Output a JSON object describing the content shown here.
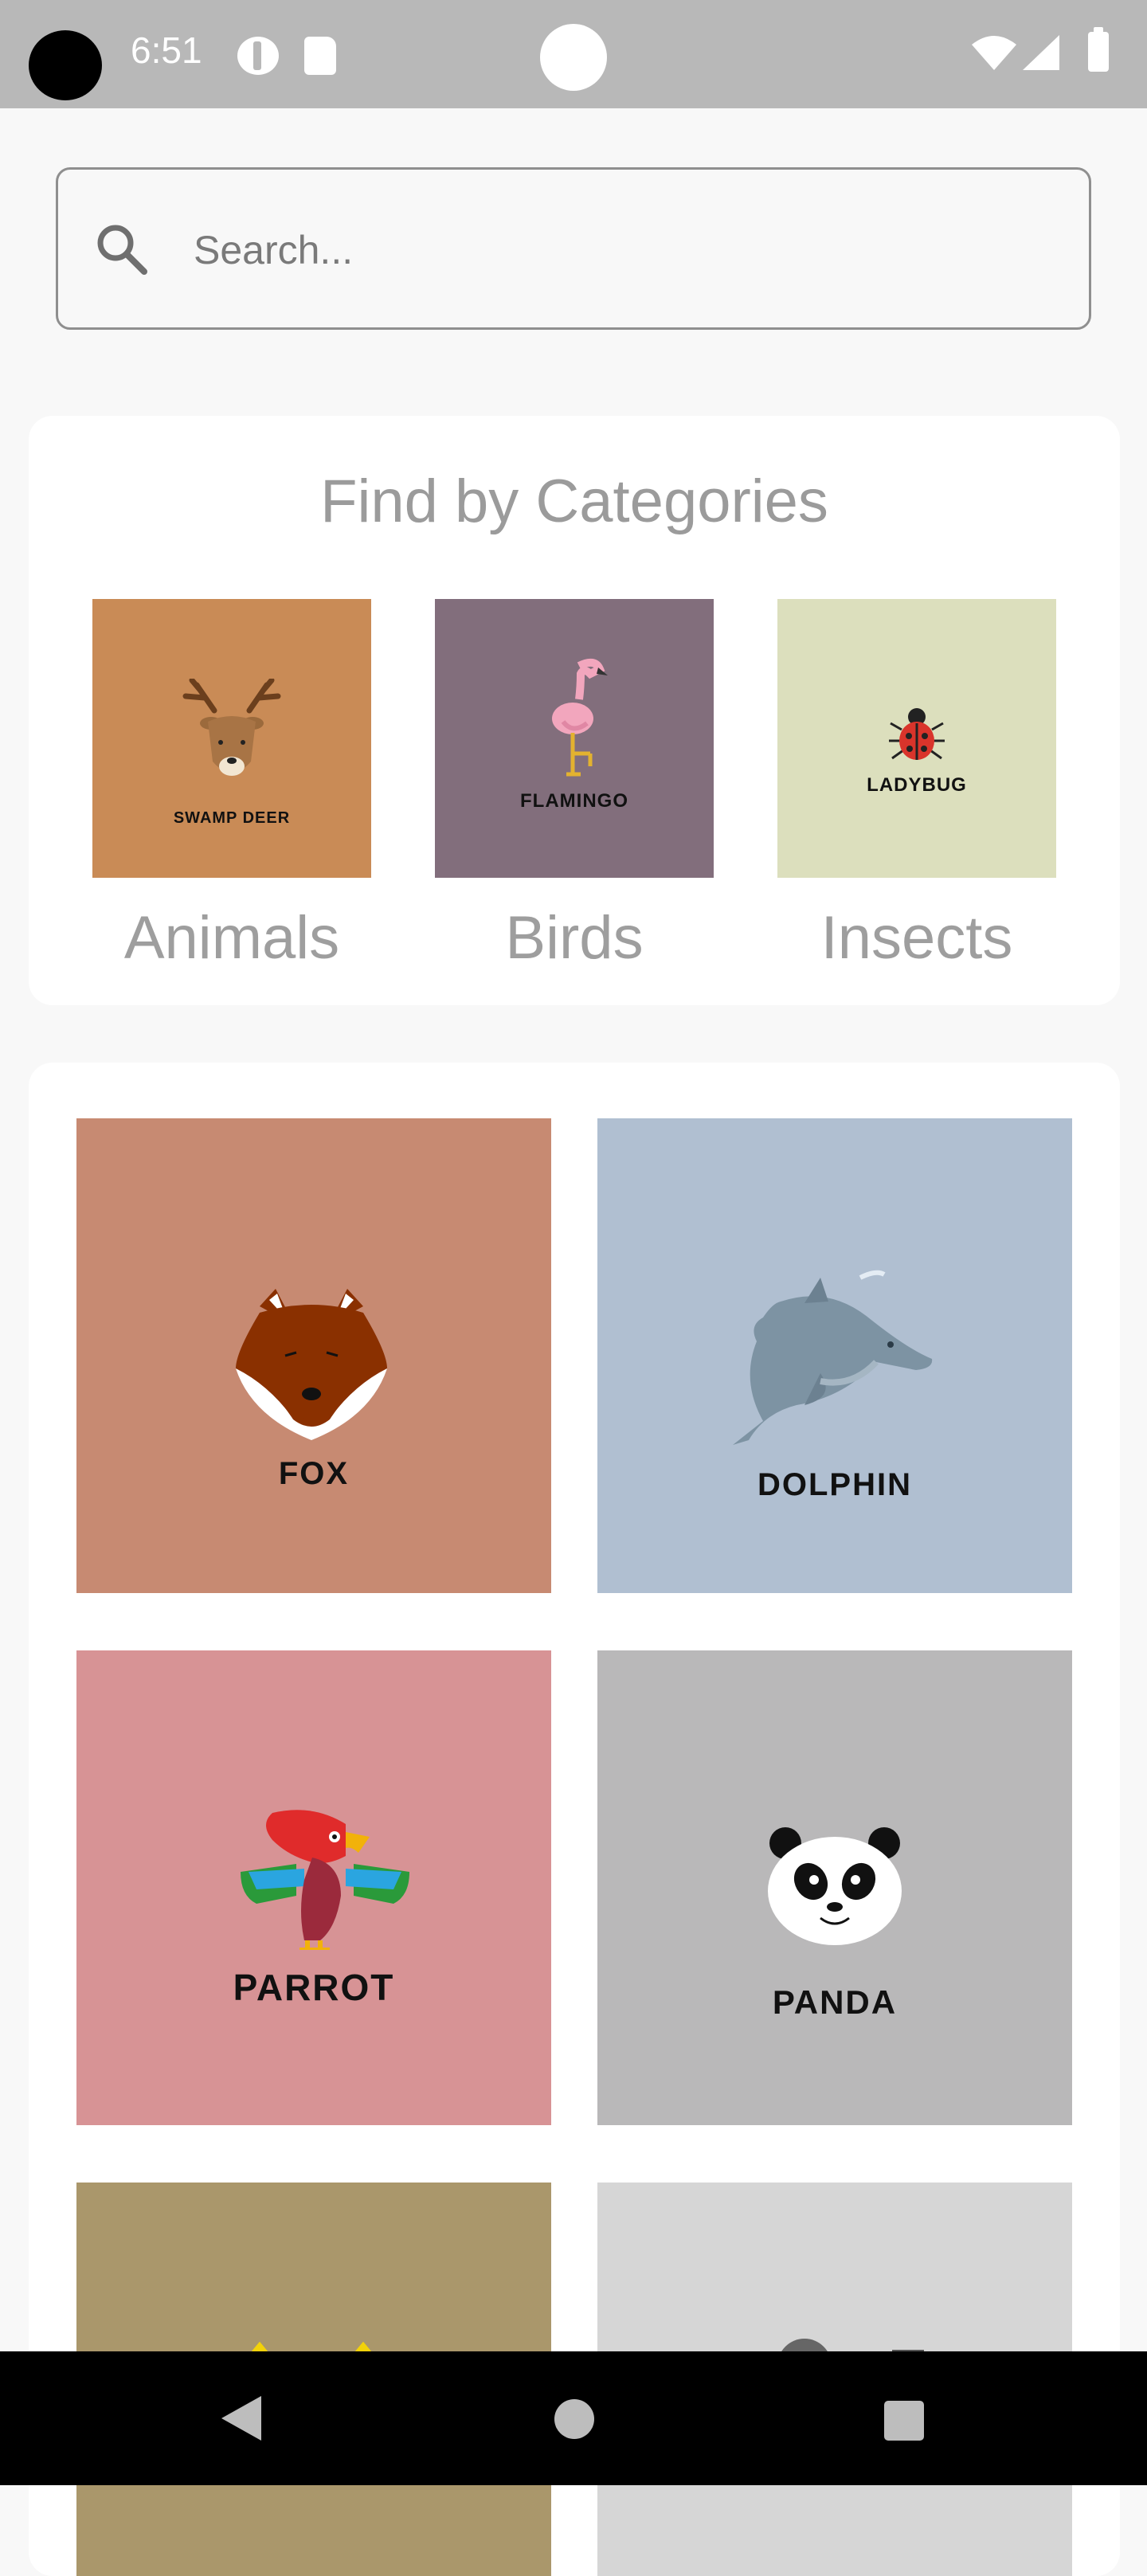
{
  "status_bar": {
    "time": "6:51"
  },
  "search": {
    "placeholder": "Search..."
  },
  "categories": {
    "title": "Find by Categories",
    "items": [
      {
        "name": "Animals",
        "tile_label": "SWAMP DEER",
        "color": "#c98b56",
        "icon": "deer-icon"
      },
      {
        "name": "Birds",
        "tile_label": "FLAMINGO",
        "color": "#826e7c",
        "icon": "flamingo-icon"
      },
      {
        "name": "Insects",
        "tile_label": "LADYBUG",
        "color": "#dcdfbd",
        "icon": "ladybug-icon"
      }
    ]
  },
  "species": [
    {
      "label": "FOX",
      "color": "#c78a72",
      "icon": "fox-icon"
    },
    {
      "label": "DOLPHIN",
      "color": "#b0bfd1",
      "icon": "dolphin-icon"
    },
    {
      "label": "PARROT",
      "color": "#d79395",
      "icon": "parrot-icon"
    },
    {
      "label": "PANDA",
      "color": "#b9b8b9",
      "icon": "panda-icon"
    },
    {
      "label": "",
      "color": "#aa976b",
      "icon": "animal-icon"
    },
    {
      "label": "",
      "color": "#d6d6d6",
      "icon": "animal-icon"
    }
  ]
}
